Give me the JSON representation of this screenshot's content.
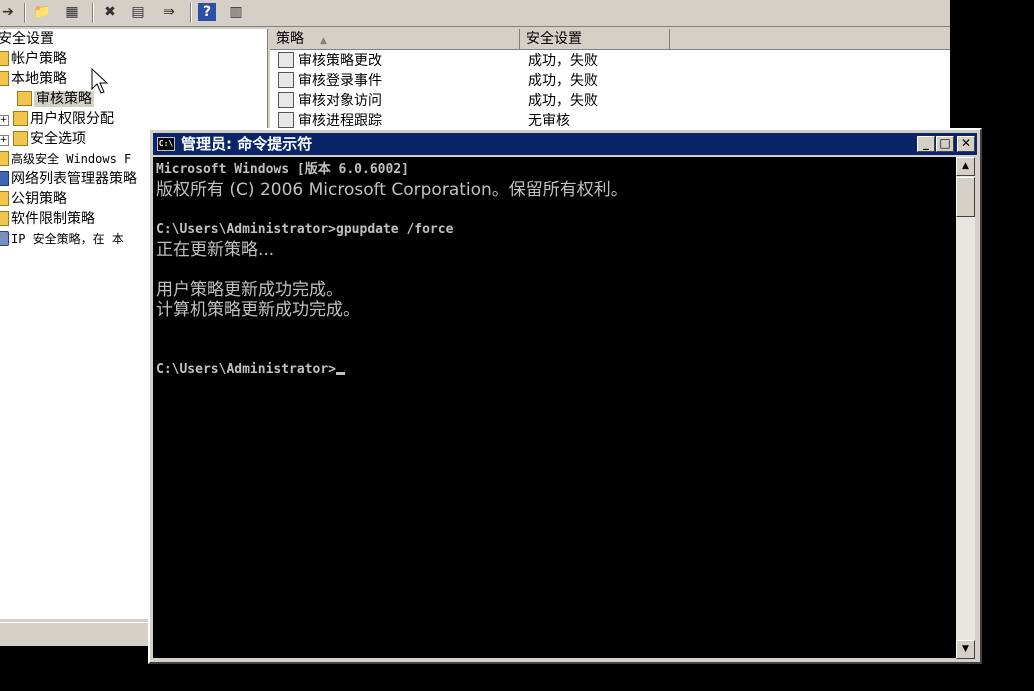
{
  "mmc": {
    "tree": {
      "items": [
        {
          "label": "安全设置"
        },
        {
          "label": "帐户策略"
        },
        {
          "label": "本地策略"
        },
        {
          "label": "审核策略"
        },
        {
          "label": "用户权限分配"
        },
        {
          "label": "安全选项"
        },
        {
          "label": "高级安全 Windows F"
        },
        {
          "label": "网络列表管理器策略"
        },
        {
          "label": "公钥策略"
        },
        {
          "label": "软件限制策略"
        },
        {
          "label": "IP 安全策略，在 本"
        }
      ]
    },
    "list": {
      "columns": [
        "策略",
        "安全设置"
      ],
      "rows": [
        {
          "policy": "审核策略更改",
          "setting": "成功，失败"
        },
        {
          "policy": "审核登录事件",
          "setting": "成功，失败"
        },
        {
          "policy": "审核对象访问",
          "setting": "成功，失败"
        },
        {
          "policy": "审核进程跟踪",
          "setting": "无审核"
        }
      ]
    }
  },
  "cmd": {
    "title": "管理员: 命令提示符",
    "icon_text": "C:\\",
    "lines": [
      "Microsoft Windows [版本 6.0.6002]",
      "版权所有 (C) 2006 Microsoft Corporation。保留所有权利。",
      "",
      "C:\\Users\\Administrator>gpupdate /force",
      "正在更新策略...",
      "",
      "用户策略更新成功完成。",
      "计算机策略更新成功完成。",
      "",
      "",
      "C:\\Users\\Administrator>"
    ]
  }
}
